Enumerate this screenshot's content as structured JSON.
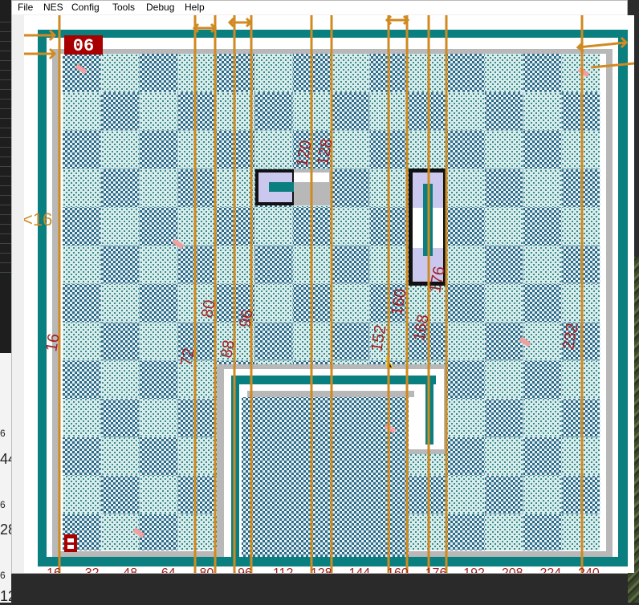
{
  "menu": [
    {
      "label": "File"
    },
    {
      "label": "NES"
    },
    {
      "label": "Config"
    },
    {
      "label": "Tools"
    },
    {
      "label": "Debug"
    },
    {
      "label": "Help"
    }
  ],
  "hud": {
    "counter": "06"
  },
  "scale_labels": [
    "16",
    "32",
    "48",
    "64",
    "80",
    "96",
    "112",
    "128",
    "144",
    "160",
    "176",
    "192",
    "208",
    "224",
    "240"
  ],
  "edge_text": {
    "left_top": "6",
    "left_mid": "44",
    "left_a": "6",
    "left_b": "28",
    "left_c": "6",
    "left_bottom": "12"
  },
  "annotations": {
    "left_arrow_label": "<16",
    "vertical_labels": [
      "16",
      "72",
      "80",
      "88",
      "96",
      "120",
      "128",
      "152",
      "160",
      "168",
      "176",
      "232"
    ]
  },
  "colors": {
    "teal": "#0a7f7f",
    "checker_dark": "#2d6a8a",
    "checker_light": "#d8ecec",
    "wall_gray": "#b8b8b8",
    "marker_orange": "#d08a20",
    "ink_red": "#a32222",
    "hud_red": "#a80000",
    "block_lavender": "#cbc8f0"
  }
}
